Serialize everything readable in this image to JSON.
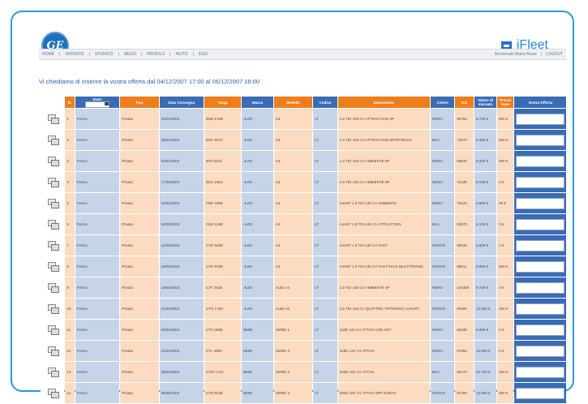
{
  "header": {
    "logo_text": "GE",
    "brand_name": "iFleet"
  },
  "nav": {
    "left": [
      "HOME",
      "OFFERTE",
      "STORICO",
      "MEZZI",
      "PROFILO",
      "AIUTO",
      "ESCI"
    ],
    "right": [
      "Benvenuto Mario Rossi",
      "LOGOUT"
    ]
  },
  "heading": "Vi chiediamo di inserire la vostra offerta dal 04/12/2007 17:00 al 06/12/2007 16:00",
  "table": {
    "columns": [
      "N.",
      "Stato",
      "Tipo",
      "Data Consegna",
      "Targa",
      "Marca",
      "Modello",
      "Codice",
      "Descrizione",
      "Colore",
      "Km",
      "Valore di mercato",
      "Prezzo base",
      "Vostra Offerta"
    ],
    "rows": [
      {
        "n": "1",
        "status": "Fermo",
        "type": "Privato",
        "date": "23/01/2004",
        "plate": "BSB 178D",
        "make": "AUDI",
        "model": "A3",
        "code": "LT",
        "desc": "1.6 TDI 105 CV ATTRACTION 3P",
        "color": "NERO",
        "km": "58750",
        "value": "8.750 €",
        "base": "500 €"
      },
      {
        "n": "2",
        "status": "Fermo",
        "type": "Privato",
        "date": "28/01/2004",
        "plate": "BSP 467C",
        "make": "AUDI",
        "model": "A3",
        "code": "LT",
        "desc": "1.6 TDI 105 CV ATTRACTION SPORTBACK",
        "color": "BLU",
        "km": "74670",
        "value": "9.450 €",
        "base": "500 €"
      },
      {
        "n": "3",
        "status": "Fermo",
        "type": "Privato",
        "date": "03/02/2004",
        "plate": "BTA 523C",
        "make": "AUDI",
        "model": "A3",
        "code": "LT",
        "desc": "1.6 TDI 105 CV AMBIENTE 5P",
        "color": "NERO",
        "km": "68540",
        "value": "8.200 €",
        "base": "500 €"
      },
      {
        "n": "4",
        "status": "Fermo",
        "type": "Privato",
        "date": "17/02/2004",
        "plate": "BSX 196C",
        "make": "AUDI",
        "model": "A3",
        "code": "LT",
        "desc": "1.9 TDI 130 CV AMBIENTE 5P",
        "color": "NERO",
        "km": "72130",
        "value": "8.100 €",
        "base": "0 €"
      },
      {
        "n": "5",
        "status": "Fermo",
        "type": "Privato",
        "date": "20/02/2004",
        "plate": "CBP 438D",
        "make": "AUDI",
        "model": "A4",
        "code": "LT",
        "desc": "AVANT 1.9 TDI 130 CV AMBIENTE",
        "color": "NERO",
        "km": "79420",
        "value": "9.800 €",
        "base": "98 €"
      },
      {
        "n": "6",
        "status": "Fermo",
        "type": "Privato",
        "date": "04/03/2004",
        "plate": "CBS 518E",
        "make": "AUDI",
        "model": "A4",
        "code": "LT",
        "desc": "AVANT 1.9 TDI 130 CV ATTRACTION",
        "color": "BLU",
        "km": "93870",
        "value": "9.100 €",
        "base": "0 €"
      },
      {
        "n": "7",
        "status": "Fermo",
        "type": "Privato",
        "date": "12/03/2004",
        "plate": "CTD 540E",
        "make": "AUDI",
        "model": "A4",
        "code": "LT",
        "desc": "AVANT 1.9 TDI 130 CV FAST",
        "color": "GRIGIO",
        "km": "99520",
        "value": "9.600 €",
        "base": "0 €"
      },
      {
        "n": "8",
        "status": "Fermo",
        "type": "Privato",
        "date": "18/03/2004",
        "plate": "CTE 978D",
        "make": "AUDI",
        "model": "A4",
        "code": "LT",
        "desc": "AVANT 1.9 TDI 130 CV FAST PLUS MULTITRONIC",
        "color": "GRIGIO",
        "km": "88511",
        "value": "9.950 €",
        "base": "600 €"
      },
      {
        "n": "9",
        "status": "Fermo",
        "type": "Privato",
        "date": "19/03/2004",
        "plate": "CTF 263E",
        "make": "AUDI",
        "model": "AUDI A4",
        "code": "LT",
        "desc": "1.9 TDI 130 CV AMBIENTE 4P",
        "color": "NERO",
        "km": "104300",
        "value": "9.700 €",
        "base": "0 €"
      },
      {
        "n": "10",
        "status": "Fermo",
        "type": "Privato",
        "date": "01/04/2004",
        "plate": "CTG 178C",
        "make": "AUDI",
        "model": "AUDI A6",
        "code": "LT",
        "desc": "2.5 TDI 163 CV QUATTRO TIPTRONIC LUXURY",
        "color": "GRIGIO",
        "km": "83090",
        "value": "13.300 €",
        "base": "200 €"
      },
      {
        "n": "11",
        "status": "Fermo",
        "type": "Privato",
        "date": "06/04/2004",
        "plate": "CTH 385E",
        "make": "BMW",
        "model": "SERIE 1",
        "code": "LT",
        "desc": "118D 122 CV ATTIVA CON SET",
        "color": "NERO",
        "km": "69230",
        "value": "9.900 €",
        "base": "0 €"
      },
      {
        "n": "12",
        "status": "Fermo",
        "type": "Privato",
        "date": "21/04/2004",
        "plate": "CTL 496C",
        "make": "BMW",
        "model": "SERIE 3",
        "code": "LT",
        "desc": "318D 122 CV ATTIVA",
        "color": "NERO",
        "km": "87550",
        "value": "10.500 €",
        "base": "0 €"
      },
      {
        "n": "13",
        "status": "Fermo",
        "type": "Privato",
        "date": "28/04/2004",
        "plate": "CTM 714C",
        "make": "BMW",
        "model": "SERIE 3",
        "code": "LT",
        "desc": "320D 150 CV ATTIVA",
        "color": "BLU",
        "km": "92170",
        "value": "12.700 €",
        "base": "400 €"
      },
      {
        "n": "14",
        "status": "Fermo",
        "type": "Privato",
        "date": "05/05/2004",
        "plate": "CTN 823E",
        "make": "BMW",
        "model": "SERIE 3",
        "code": "LT",
        "desc": "320D 150 CV ATTIVA DPF EURO4",
        "color": "GRIGIO",
        "km": "97450",
        "value": "13.000 €",
        "base": "200 €"
      }
    ]
  },
  "colors": {
    "accent_blue": "#3a6cb5",
    "accent_orange": "#ee7d1b",
    "frame": "#2a9bd6"
  },
  "icons": {
    "row_action": "copy-document-icon"
  }
}
